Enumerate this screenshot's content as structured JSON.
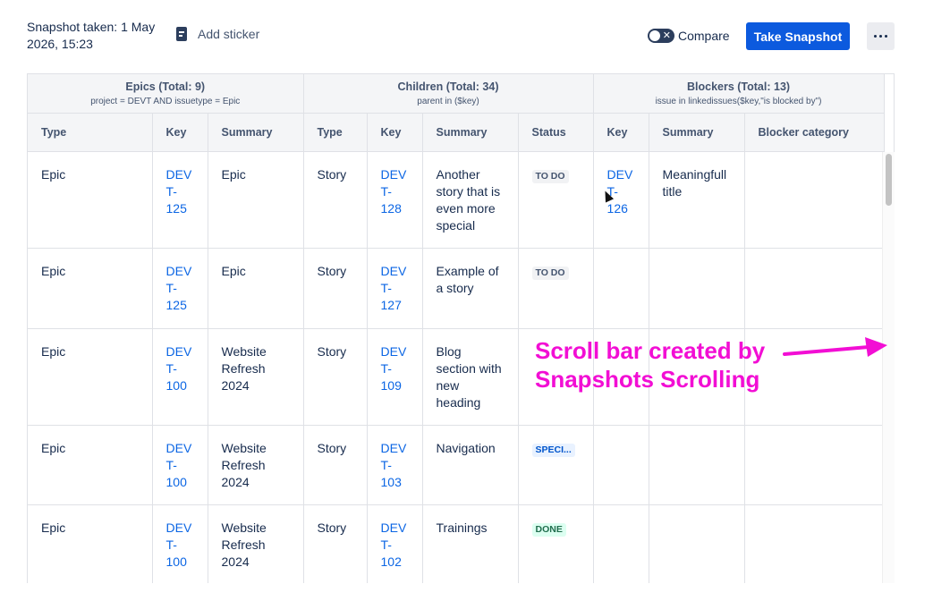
{
  "toolbar": {
    "snapshot_info": "Snapshot taken: 1 May 2026, 15:23",
    "add_sticker_label": "Add sticker",
    "compare_label": "Compare",
    "take_snapshot_label": "Take Snapshot"
  },
  "groups": {
    "epics": {
      "title": "Epics (Total: 9)",
      "subtitle": "project = DEVT AND issuetype = Epic"
    },
    "children": {
      "title": "Children (Total: 34)",
      "subtitle": "parent in ($key)"
    },
    "blockers": {
      "title": "Blockers (Total: 13)",
      "subtitle": "issue in linkedissues($key,\"is blocked by\")"
    }
  },
  "columns": [
    "Type",
    "Key",
    "Summary",
    "Type",
    "Key",
    "Summary",
    "Status",
    "Key",
    "Summary",
    "Blocker category"
  ],
  "rows": [
    {
      "epic_type": "Epic",
      "epic_key": "DEV T- 125",
      "epic_summary": "Epic",
      "child_type": "Story",
      "child_key": "DEV T- 128",
      "child_summary": "Another story that is even more special",
      "status": "TO DO",
      "blocker_key": "DEV T- 126",
      "blocker_summary": "Meaningfull title",
      "blocker_category": ""
    },
    {
      "epic_type": "Epic",
      "epic_key": "DEV T- 125",
      "epic_summary": "Epic",
      "child_type": "Story",
      "child_key": "DEV T- 127",
      "child_summary": "Example of a story",
      "status": "TO DO",
      "blocker_key": "",
      "blocker_summary": "",
      "blocker_category": ""
    },
    {
      "epic_type": "Epic",
      "epic_key": "DEV T- 100",
      "epic_summary": "Website Refresh 2024",
      "child_type": "Story",
      "child_key": "DEV T- 109",
      "child_summary": "Blog section with new heading",
      "status": "",
      "blocker_key": "",
      "blocker_summary": "",
      "blocker_category": ""
    },
    {
      "epic_type": "Epic",
      "epic_key": "DEV T- 100",
      "epic_summary": "Website Refresh 2024",
      "child_type": "Story",
      "child_key": "DEV T- 103",
      "child_summary": "Navigation",
      "status": "SPECI...",
      "blocker_key": "",
      "blocker_summary": "",
      "blocker_category": ""
    },
    {
      "epic_type": "Epic",
      "epic_key": "DEV T- 100",
      "epic_summary": "Website Refresh 2024",
      "child_type": "Story",
      "child_key": "DEV T- 102",
      "child_summary": "Trainings",
      "status": "DONE",
      "blocker_key": "",
      "blocker_summary": "",
      "blocker_category": ""
    }
  ],
  "annotation": {
    "text": "Scroll bar created by\nSnapshots Scrolling",
    "color": "#f20ed4"
  },
  "colors": {
    "primary_button": "#0c5ade",
    "link": "#0c66e4",
    "header_bg": "#f4f5f7"
  }
}
